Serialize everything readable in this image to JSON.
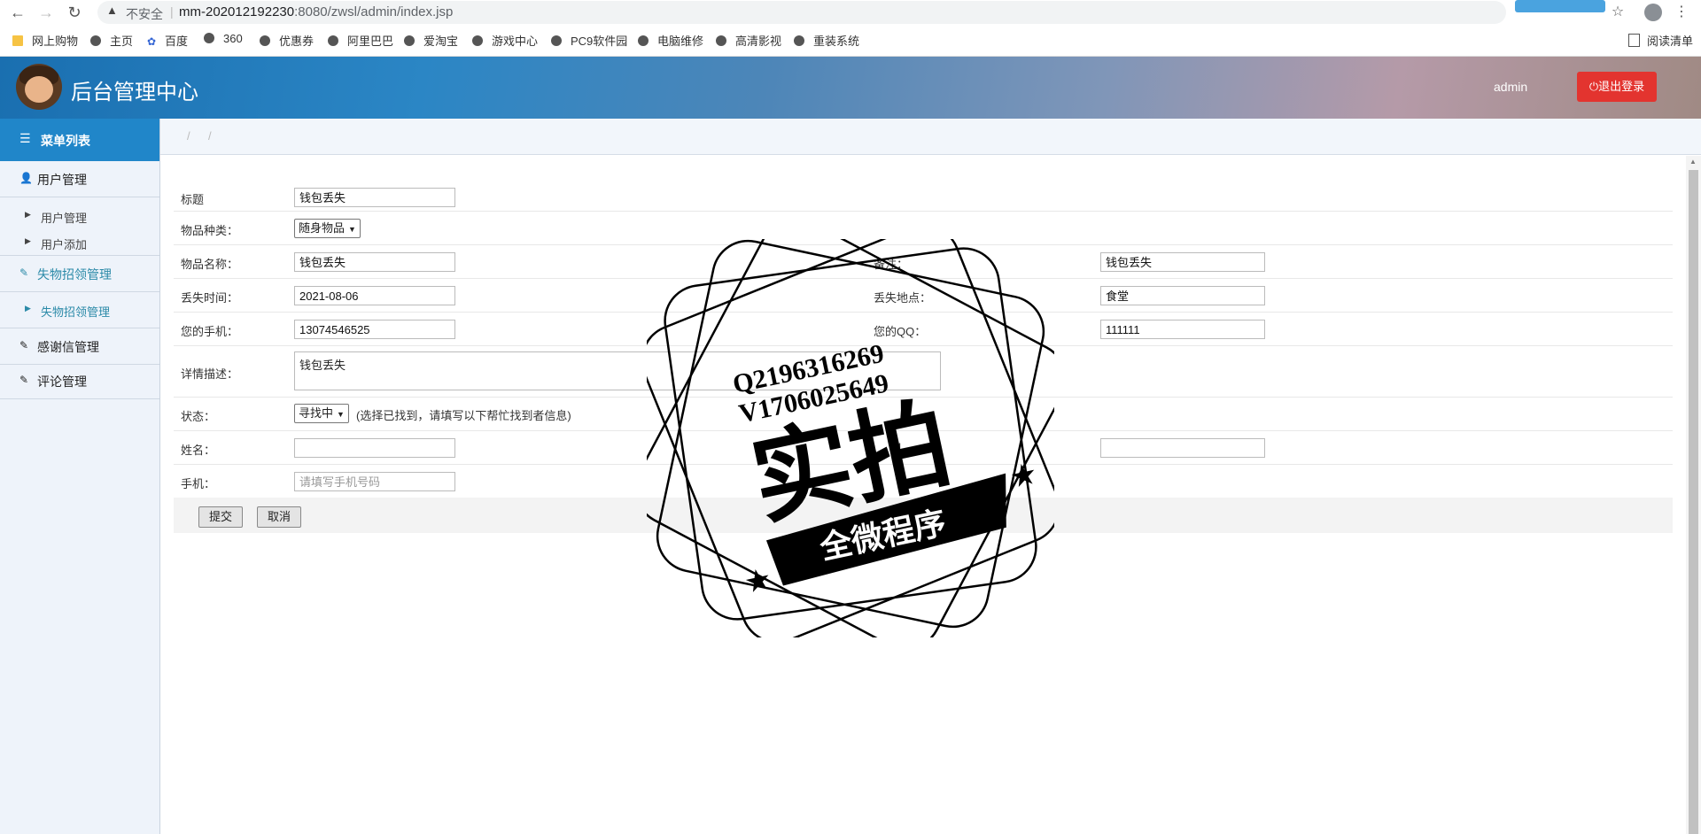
{
  "browser": {
    "security_label": "不安全",
    "url_host": "mm-202012192230",
    "url_rest": ":8080/zwsl/admin/index.jsp",
    "bookmarks": [
      "网上购物",
      "主页",
      "百度",
      "360",
      "优惠券",
      "阿里巴巴",
      "爱淘宝",
      "游戏中心",
      "PC9软件园",
      "电脑维修",
      "高清影视",
      "重装系统"
    ],
    "reading_list": "阅读清单"
  },
  "header": {
    "title": "后台管理中心",
    "user": "admin",
    "logout_label": "退出登录"
  },
  "sidebar": {
    "menu_title": "菜单列表",
    "groups": [
      {
        "label": "用户管理",
        "items": [
          "用户管理",
          "用户添加"
        ]
      },
      {
        "label": "失物招领管理",
        "items": [
          "失物招领管理"
        ]
      },
      {
        "label": "感谢信管理",
        "items": []
      },
      {
        "label": "评论管理",
        "items": []
      }
    ]
  },
  "breadcrumb": {
    "sep1": "/",
    "sep2": "/"
  },
  "form": {
    "title_label": "标题",
    "title_value": "钱包丢失",
    "category_label": "物品种类：",
    "category_value": "随身物品",
    "item_name_label": "物品名称：",
    "item_name_value": "钱包丢失",
    "remark_label": "备注：",
    "remark_value": "钱包丢失",
    "lost_time_label": "丢失时间：",
    "lost_time_value": "2021-08-06",
    "lost_place_label": "丢失地点：",
    "lost_place_value": "食堂",
    "phone_label": "您的手机：",
    "phone_value": "13074546525",
    "qq_label": "您的QQ：",
    "qq_value": "111111",
    "detail_label": "详情描述：",
    "detail_value": "钱包丢失",
    "status_label": "状态：",
    "status_value": "寻找中",
    "status_hint": "(选择已找到，请填写以下帮忙找到者信息)",
    "finder_name_label": "姓名：",
    "finder_name_value": "",
    "finder_email_label": "ail",
    "finder_email_value": "",
    "finder_phone_label": "手机：",
    "finder_phone_placeholder": "请填写手机号码",
    "submit_label": "提交",
    "cancel_label": "取消"
  },
  "watermark": {
    "line1": "Q2196316269",
    "line2": "V1706025649",
    "main": "实拍",
    "banner": "全微程序"
  }
}
